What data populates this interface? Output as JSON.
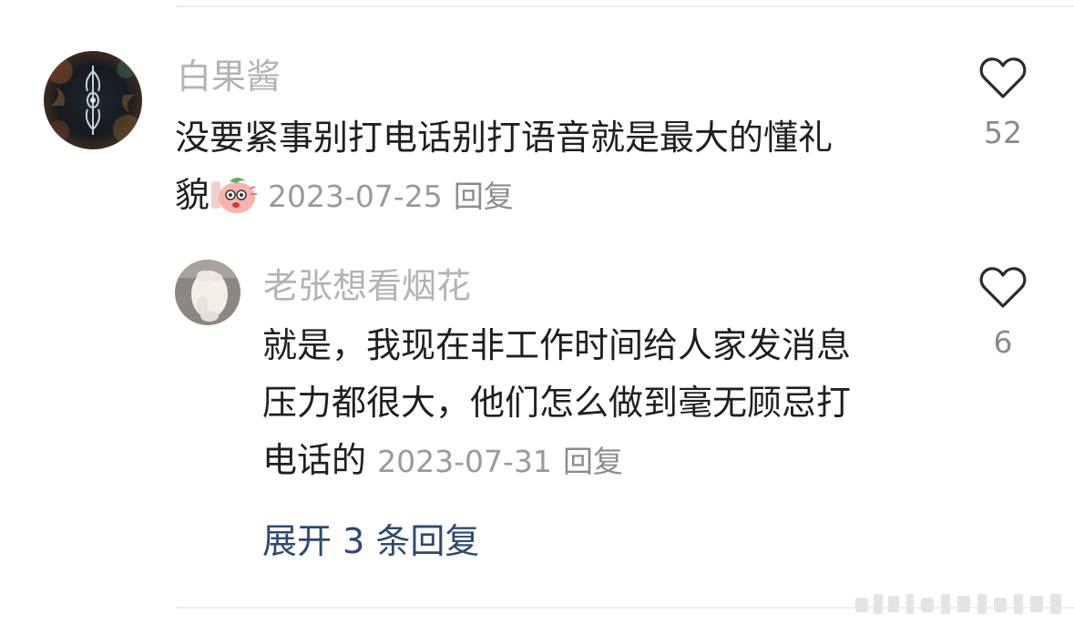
{
  "comment": {
    "username": "白果酱",
    "text_line1": "没要紧事别打电话别打语音就是最大的懂礼",
    "text_line2": "貌",
    "date": "2023-07-25",
    "reply_label": "回复",
    "like_count": "52"
  },
  "reply": {
    "username": "老张想看烟花",
    "text_line1": "就是，我现在非工作时间给人家发消息",
    "text_line2": "压力都很大，他们怎么做到毫无顾忌打",
    "text_line3": "电话的",
    "date": "2023-07-31",
    "reply_label": "回复",
    "like_count": "6"
  },
  "expand_label": "展开 3 条回复",
  "colors": {
    "username": "#b3b3b3",
    "meta": "#9a9a9a",
    "link": "#2c4a73",
    "divider": "#ededed"
  }
}
